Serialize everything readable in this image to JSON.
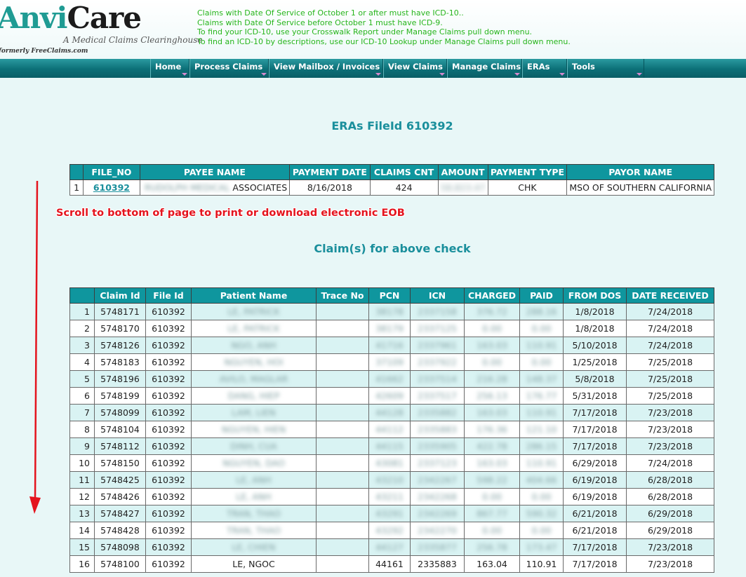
{
  "logo": {
    "part1": "Anvi",
    "part2": "Care",
    "tagline": "A Medical Claims Clearinghouse",
    "formerly": "formerly FreeClaims.com"
  },
  "notices": [
    "Claims with Date Of Service of October 1 or after must have ICD-10..",
    "Claims with Date Of Service before October 1 must have ICD-9.",
    "To find your ICD-10, use your Crosswalk Report under Manage Claims pull down menu.",
    "To find an ICD-10 by descriptions, use our ICD-10 Lookup under Manage Claims pull down menu."
  ],
  "nav": [
    "Home",
    "Process Claims",
    "View Mailbox / Invoices",
    "View Claims",
    "Manage Claims",
    "ERAs",
    "Tools"
  ],
  "page_title": "ERAs FileId 610392",
  "file_table": {
    "headers": [
      "",
      "FILE_NO",
      "PAYEE NAME",
      "PAYMENT DATE",
      "CLAIMS CNT",
      "AMOUNT",
      "PAYMENT TYPE",
      "PAYOR NAME"
    ],
    "row": {
      "idx": "1",
      "file_no": "610392",
      "payee_blurred": "RUDOLPH MEDICAL",
      "payee_visible": "ASSOCIATES",
      "payment_date": "8/16/2018",
      "claims_cnt": "424",
      "amount_blurred": "58,823.47",
      "payment_type": "CHK",
      "payor_name": "MSO OF SOUTHERN CALIFORNIA"
    }
  },
  "scroll_note": "Scroll to bottom of page to print or download electronic EOB",
  "claims_title": "Claim(s) for above check",
  "claims_table": {
    "headers": [
      "",
      "Claim Id",
      "File Id",
      "Patient Name",
      "Trace No",
      "PCN",
      "ICN",
      "CHARGED",
      "PAID",
      "FROM DOS",
      "DATE RECEIVED"
    ],
    "rows": [
      [
        "1",
        "5748171",
        "610392",
        "LE, PATRICK",
        "",
        "38178",
        "2337158",
        "376.72",
        "288.16",
        "1/8/2018",
        "7/24/2018"
      ],
      [
        "2",
        "5748170",
        "610392",
        "LE, PATRICK",
        "",
        "38179",
        "2337125",
        "0.00",
        "0.00",
        "1/8/2018",
        "7/24/2018"
      ],
      [
        "3",
        "5748126",
        "610392",
        "NGO, ANH",
        "",
        "41716",
        "2337961",
        "163.03",
        "110.91",
        "5/10/2018",
        "7/24/2018"
      ],
      [
        "4",
        "5748183",
        "610392",
        "NGUYEN, HOI",
        "",
        "37109",
        "2337922",
        "0.00",
        "0.00",
        "1/25/2018",
        "7/25/2018"
      ],
      [
        "5",
        "5748196",
        "610392",
        "AVILO, MAGLAR",
        "",
        "41662",
        "2337514",
        "216.28",
        "148.37",
        "5/8/2018",
        "7/25/2018"
      ],
      [
        "6",
        "5748199",
        "610392",
        "DANG, HIEP",
        "",
        "42609",
        "2337517",
        "256.13",
        "176.77",
        "5/31/2018",
        "7/25/2018"
      ],
      [
        "7",
        "5748099",
        "610392",
        "LAM, LIEN",
        "",
        "44128",
        "2335882",
        "163.03",
        "110.91",
        "7/17/2018",
        "7/23/2018"
      ],
      [
        "8",
        "5748104",
        "610392",
        "NGUYEN, HIEN",
        "",
        "44112",
        "2335883",
        "176.36",
        "121.10",
        "7/17/2018",
        "7/23/2018"
      ],
      [
        "9",
        "5748112",
        "610392",
        "DINH, CUA",
        "",
        "44115",
        "2335905",
        "422.78",
        "286.15",
        "7/17/2018",
        "7/23/2018"
      ],
      [
        "10",
        "5748150",
        "610392",
        "NGUYEN, DAO",
        "",
        "43081",
        "2337123",
        "163.03",
        "110.91",
        "6/29/2018",
        "7/24/2018"
      ],
      [
        "11",
        "5748425",
        "610392",
        "LE, ANH",
        "",
        "43210",
        "2342267",
        "598.22",
        "404.66",
        "6/19/2018",
        "6/28/2018"
      ],
      [
        "12",
        "5748426",
        "610392",
        "LE, ANH",
        "",
        "43211",
        "2342268",
        "0.00",
        "0.00",
        "6/19/2018",
        "6/28/2018"
      ],
      [
        "13",
        "5748427",
        "610392",
        "TRAN, THAO",
        "",
        "43291",
        "2342269",
        "867.77",
        "590.32",
        "6/21/2018",
        "6/29/2018"
      ],
      [
        "14",
        "5748428",
        "610392",
        "TRAN, THAO",
        "",
        "43292",
        "2342270",
        "0.00",
        "0.00",
        "6/21/2018",
        "6/29/2018"
      ],
      [
        "15",
        "5748098",
        "610392",
        "LE, CHIEN",
        "",
        "44127",
        "2335877",
        "256.78",
        "173.47",
        "7/17/2018",
        "7/23/2018"
      ],
      [
        "16",
        "5748100",
        "610392",
        "LE, NGOC",
        "",
        "44161",
        "2335883",
        "163.04",
        "110.91",
        "7/17/2018",
        "7/23/2018"
      ]
    ]
  },
  "colors": {
    "accent": "#0f969e",
    "title": "#1a8f9c",
    "notice": "#27b51c",
    "note": "#e4141e"
  }
}
